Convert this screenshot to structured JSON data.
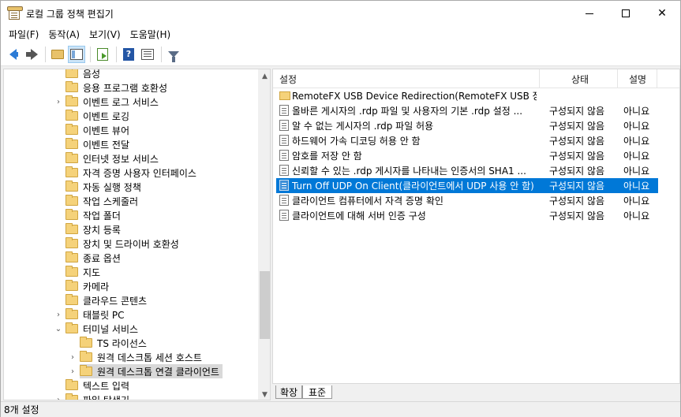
{
  "window": {
    "title": "로컬 그룹 정책 편집기"
  },
  "menu": [
    "파일(F)",
    "동작(A)",
    "보기(V)",
    "도움말(H)"
  ],
  "tree": {
    "items": [
      {
        "label": "음성",
        "level": 0,
        "expander": ""
      },
      {
        "label": "응용 프로그램 호환성",
        "level": 0,
        "expander": ""
      },
      {
        "label": "이벤트 로그 서비스",
        "level": 0,
        "expander": "›"
      },
      {
        "label": "이벤트 로깅",
        "level": 0,
        "expander": ""
      },
      {
        "label": "이벤트 뷰어",
        "level": 0,
        "expander": ""
      },
      {
        "label": "이벤트 전달",
        "level": 0,
        "expander": ""
      },
      {
        "label": "인터넷 정보 서비스",
        "level": 0,
        "expander": ""
      },
      {
        "label": "자격 증명 사용자 인터페이스",
        "level": 0,
        "expander": ""
      },
      {
        "label": "자동 실행 정책",
        "level": 0,
        "expander": ""
      },
      {
        "label": "작업 스케줄러",
        "level": 0,
        "expander": ""
      },
      {
        "label": "작업 폴더",
        "level": 0,
        "expander": ""
      },
      {
        "label": "장치 등록",
        "level": 0,
        "expander": ""
      },
      {
        "label": "장치 및 드라이버 호환성",
        "level": 0,
        "expander": ""
      },
      {
        "label": "종료 옵션",
        "level": 0,
        "expander": ""
      },
      {
        "label": "지도",
        "level": 0,
        "expander": ""
      },
      {
        "label": "카메라",
        "level": 0,
        "expander": ""
      },
      {
        "label": "클라우드 콘텐츠",
        "level": 0,
        "expander": ""
      },
      {
        "label": "태블릿 PC",
        "level": 0,
        "expander": "›"
      },
      {
        "label": "터미널 서비스",
        "level": 0,
        "expander": "⌄"
      },
      {
        "label": "TS 라이선스",
        "level": 1,
        "expander": ""
      },
      {
        "label": "원격 데스크톱 세션 호스트",
        "level": 1,
        "expander": "›"
      },
      {
        "label": "원격 데스크톱 연결 클라이언트",
        "level": 1,
        "expander": "›",
        "selected": true
      },
      {
        "label": "텍스트 입력",
        "level": 0,
        "expander": ""
      },
      {
        "label": "파일 탐색기",
        "level": 0,
        "expander": "›"
      }
    ]
  },
  "list": {
    "columns": {
      "setting": "설정",
      "state": "상태",
      "comment": "설명"
    },
    "rows": [
      {
        "name": "RemoteFX USB Device Redirection(RemoteFX USB 장치 ...",
        "state": "",
        "comment": "",
        "type": "folder"
      },
      {
        "name": "올바른 게시자의 .rdp 파일 및 사용자의 기본 .rdp 설정 ...",
        "state": "구성되지 않음",
        "comment": "아니요",
        "type": "setting"
      },
      {
        "name": "알 수 없는 게시자의 .rdp 파일 허용",
        "state": "구성되지 않음",
        "comment": "아니요",
        "type": "setting"
      },
      {
        "name": "하드웨어 가속 디코딩 허용 안 함",
        "state": "구성되지 않음",
        "comment": "아니요",
        "type": "setting"
      },
      {
        "name": "암호를 저장 안 함",
        "state": "구성되지 않음",
        "comment": "아니요",
        "type": "setting"
      },
      {
        "name": "신뢰할 수 있는 .rdp 게시자를 나타내는 인증서의 SHA1 ...",
        "state": "구성되지 않음",
        "comment": "아니요",
        "type": "setting"
      },
      {
        "name": "Turn Off UDP On Client(클라이언트에서 UDP 사용 안 함)",
        "state": "구성되지 않음",
        "comment": "아니요",
        "type": "setting",
        "selected": true
      },
      {
        "name": "클라이언트 컴퓨터에서 자격 증명 확인",
        "state": "구성되지 않음",
        "comment": "아니요",
        "type": "setting"
      },
      {
        "name": "클라이언트에 대해 서버 인증 구성",
        "state": "구성되지 않음",
        "comment": "아니요",
        "type": "setting"
      }
    ]
  },
  "tabs": {
    "extended": "확장",
    "standard": "표준"
  },
  "status": {
    "count_text": "8개 설정"
  },
  "colors": {
    "selection": "#0078d7",
    "tree_selection": "#d9d9d9"
  }
}
